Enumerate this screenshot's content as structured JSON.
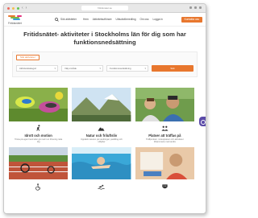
{
  "browser": {
    "url": "fritidsnatet.se"
  },
  "header": {
    "logo_text": "Fritidsnätet",
    "search_label": "Sök aktiviteter",
    "nav": [
      "Hem",
      "Aktivitetsutförare",
      "Utbudsförmedling",
      "Om oss",
      "Logga in"
    ],
    "login_label": "Kontakta oss"
  },
  "hero": {
    "title": "Fritidsnätet- aktiviteter i Stockholms län för dig som har funktionsnedsättning"
  },
  "search_panel": {
    "tab_label": "Sök aktiviteter",
    "selects": [
      "Aktivitetskategori",
      "Välj område",
      "Funktionsnedsättning"
    ],
    "search_button": "Sök"
  },
  "cards": [
    {
      "title": "Idrott och motion",
      "desc": "Träna på egen hand eller gå med i en förening nära dig",
      "icon": "running-person-icon"
    },
    {
      "title": "Natur och friluftsliv",
      "desc": "Upptäck naturen på vandringar, paddling och utflykter",
      "icon": "mountain-icon"
    },
    {
      "title": "Platser att träffas på",
      "desc": "Träffpunkter, mötesplatser och aktiviteter tillsammans med andra",
      "icon": "people-group-icon"
    },
    {
      "title": "",
      "desc": "",
      "icon": "wheelchair-icon"
    },
    {
      "title": "",
      "desc": "",
      "icon": "swimmer-icon"
    },
    {
      "title": "",
      "desc": "",
      "icon": "theater-icon"
    }
  ],
  "colors": {
    "accent": "#e8772e",
    "side_tab": "#5b4ba8"
  }
}
